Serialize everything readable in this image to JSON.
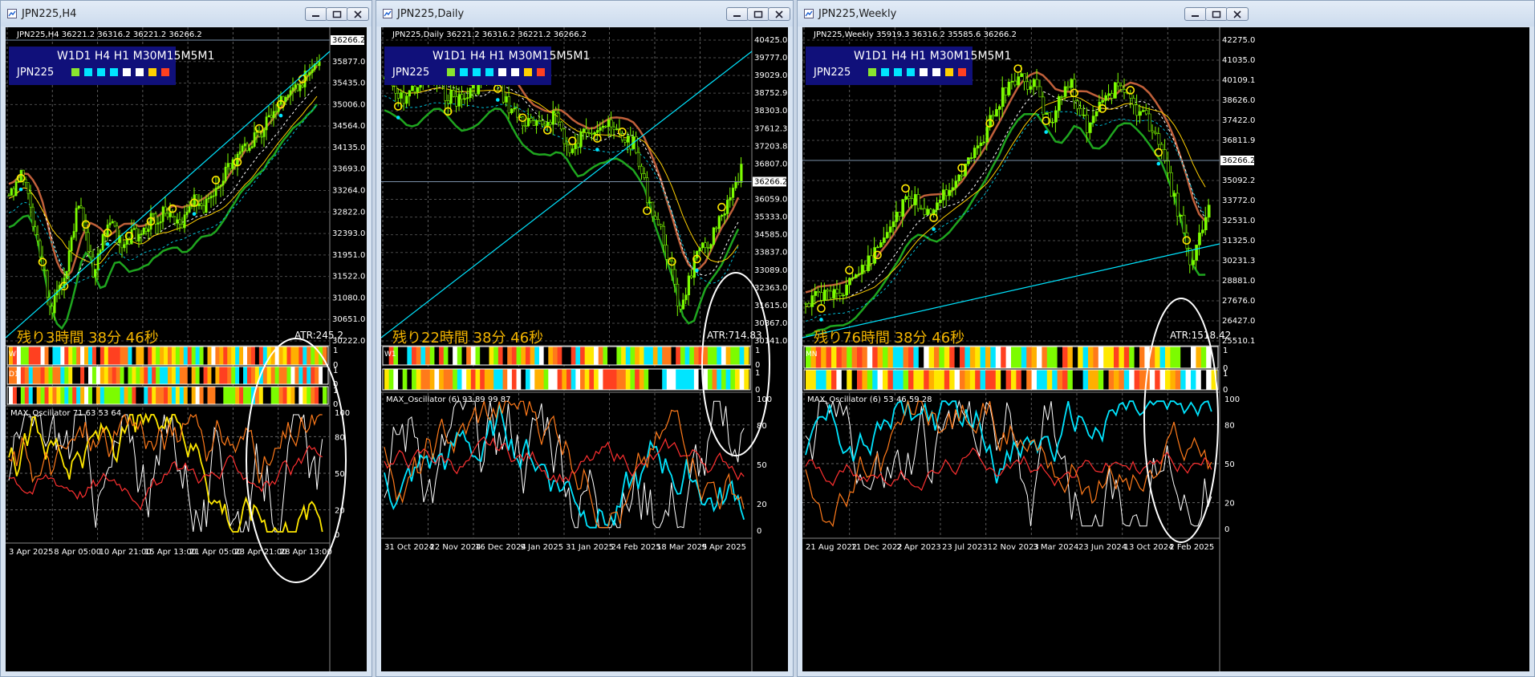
{
  "colors": {
    "bull": "#7cfc00",
    "bear": "#ff3030",
    "cyan": "#00e5ff",
    "yellow": "#ffe800",
    "orange": "#ff7a1a",
    "white": "#ffffff",
    "green": "#1f9a1f",
    "brown": "#c0603a",
    "atr_label": "#f2b400",
    "panel": "#10107a"
  },
  "icons": {
    "window": "chart-window-icon",
    "minimize": "minimize-icon",
    "maximize": "maximize-icon",
    "close": "close-icon"
  },
  "tf_panel": {
    "header": "W1D1 H4 H1 M30M15M5M1",
    "symbol": "JPN225",
    "squares": [
      "#8ae62e",
      "#00e5ff",
      "#00e5ff",
      "#00e5ff",
      "#ffffff",
      "#ffffff",
      "#ffd000",
      "#ff4020"
    ]
  },
  "windows": [
    {
      "title": "JPN225,H4",
      "info": "JPN225,H4  36221.2 36316.2 36221.2 36266.2",
      "remaining": "残り3時間 38分 46秒",
      "atr": "ATR:245.2",
      "osc_label": "MAX_Oscillator 71 63 53 64",
      "row_labels": [
        "W1",
        "D1",
        ""
      ],
      "price_labels": [
        "36266.2",
        "35877.0",
        "35435.0",
        "35006.0",
        "34564.0",
        "34135.0",
        "33693.0",
        "33264.0",
        "32822.0",
        "32393.0",
        "31951.0",
        "31522.0",
        "31080.0",
        "30651.0",
        "30222.0"
      ],
      "current_price": "36266.2",
      "osc_levels": [
        "100",
        "80",
        "50",
        "20",
        "0"
      ],
      "bar_levels": [
        "1",
        "0",
        "1",
        "0",
        "1",
        "0"
      ],
      "x_labels": [
        "3 Apr 2025",
        "8 Apr 05:00",
        "10 Apr 21:00",
        "15 Apr 13:00",
        "21 Apr 05:00",
        "23 Apr 21:00",
        "28 Apr 13:00"
      ]
    },
    {
      "title": "JPN225,Daily",
      "info": "JPN225,Daily  36221.2 36316.2 36221.2 36266.2",
      "remaining": "残り22時間 38分 46秒",
      "atr": "ATR:714.83",
      "osc_label": "MAX_Oscillator (6) 93 89 99 87",
      "row_labels": [
        "W1",
        ""
      ],
      "price_labels": [
        "40425.0",
        "39777.0",
        "39029.0",
        "38752.9",
        "38303.0",
        "37612.3",
        "37203.8",
        "36807.0",
        "36266.2",
        "36059.0",
        "35333.0",
        "34585.0",
        "33837.0",
        "33089.0",
        "32363.0",
        "31615.0",
        "30867.0",
        "30141.0"
      ],
      "current_price": "36266.2",
      "osc_levels": [
        "100",
        "80",
        "50",
        "20",
        "0"
      ],
      "bar_levels": [
        "1",
        "0",
        "1",
        "0"
      ],
      "x_labels": [
        "31 Oct 2024",
        "22 Nov 2024",
        "16 Dec 2024",
        "9 Jan 2025",
        "31 Jan 2025",
        "24 Feb 2025",
        "18 Mar 2025",
        "9 Apr 2025"
      ]
    },
    {
      "title": "JPN225,Weekly",
      "info": "JPN225,Weekly  35919.3 36316.2 35585.6 36266.2",
      "remaining": "残り76時間 38分 46秒",
      "atr": "ATR:1518.42",
      "osc_label": "MAX_Oscillator (6) 53 46 59 28",
      "row_labels": [
        "MN",
        ""
      ],
      "price_labels": [
        "42275.0",
        "41035.0",
        "40109.1",
        "38626.0",
        "37422.0",
        "36811.9",
        "36266.2",
        "35092.2",
        "33772.0",
        "32531.0",
        "31325.0",
        "30231.3",
        "28881.0",
        "27676.0",
        "26427.0",
        "25510.1"
      ],
      "current_price": "36266.2",
      "osc_levels": [
        "100",
        "80",
        "50",
        "20",
        "0"
      ],
      "bar_levels": [
        "1",
        "0",
        "1",
        "0"
      ],
      "x_labels": [
        "21 Aug 2022",
        "11 Dec 2022",
        "2 Apr 2023",
        "23 Jul 2023",
        "12 Nov 2023",
        "3 Mar 2024",
        "23 Jun 2024",
        "13 Oct 2024",
        "2 Feb 2025"
      ]
    }
  ]
}
